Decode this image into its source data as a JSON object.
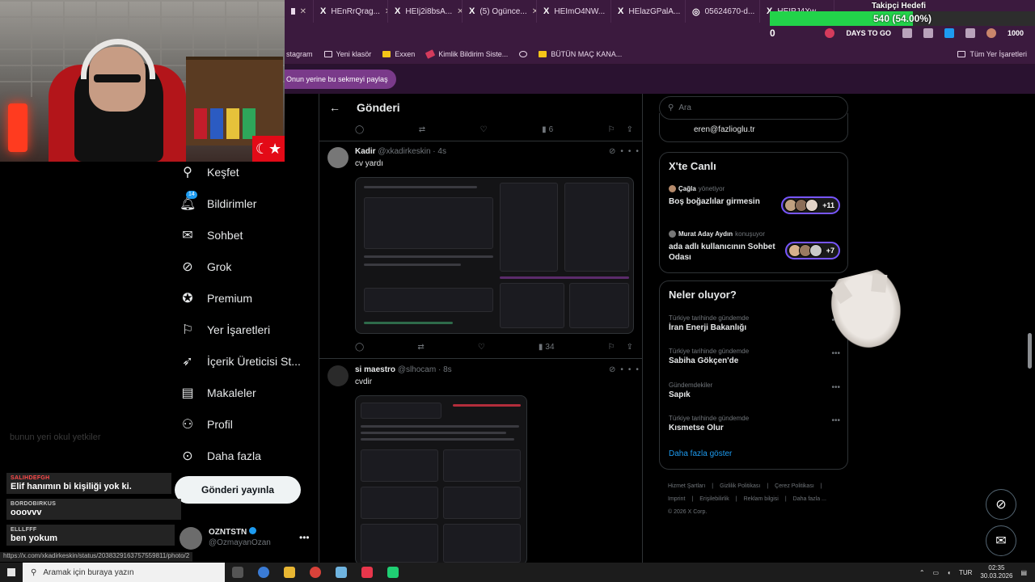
{
  "browser": {
    "tabs": [
      "HEnRrQrag...",
      "HEIj2i8bsA...",
      "(5) Ogünce...",
      "HEImO4NW...",
      "HElazGPalA...",
      "05624670-d...",
      "HEIPJ4Xw..."
    ],
    "bookmarks": [
      "stagram",
      "Yeni klasör",
      "Exxen",
      "Kimlik Bildirim Siste...",
      "BÜTÜN MAÇ KANA..."
    ],
    "bookmarks_right": "Tüm Yer İşaretleri",
    "toolbar_text": "DAYS TO GO",
    "toolbar_count": "1000",
    "share_prompt": "Onun yerine bu sekmeyi paylaş"
  },
  "stream_overlay": {
    "goal_title": "Takipçi Hedefi",
    "goal_text": "540 (54.00%)",
    "goal_progress": 0.54,
    "goal_left_value": "0",
    "flag_symbol": "☾★"
  },
  "nav": {
    "items": [
      {
        "label": "Keşfet",
        "icon": "search-icon"
      },
      {
        "label": "Bildirimler",
        "icon": "bell-icon",
        "badge": "14"
      },
      {
        "label": "Sohbet",
        "icon": "mail-icon"
      },
      {
        "label": "Grok",
        "icon": "grok-icon"
      },
      {
        "label": "Premium",
        "icon": "premium-icon"
      },
      {
        "label": "Yer İşaretleri",
        "icon": "bookmark-icon"
      },
      {
        "label": "İçerik Üreticisi St...",
        "icon": "rocket-icon"
      },
      {
        "label": "Makaleler",
        "icon": "article-icon"
      },
      {
        "label": "Profil",
        "icon": "profile-icon"
      },
      {
        "label": "Daha fazla",
        "icon": "more-circle-icon"
      }
    ],
    "post_button": "Gönderi yayınla",
    "account": {
      "name": "OZNTSTN",
      "handle": "@OzmayanOzan"
    }
  },
  "chat": [
    {
      "user": "SALIHDEFGH",
      "message": "Elif hanımın bi kişiliği yok ki."
    },
    {
      "user": "BORDOBIRKUS",
      "message": "ooovvv"
    },
    {
      "user": "ELLLFFF",
      "message": "ben yokum"
    }
  ],
  "chat_ghost": "bunun yeri okul yetkiler",
  "feed": {
    "title": "Gönderi",
    "top_actions": {
      "views": "6"
    },
    "posts": [
      {
        "name": "Kadir",
        "handle": "@xkadirkeskin",
        "time": "4s",
        "text": "cv yardı",
        "views": "34"
      },
      {
        "name": "si maestro",
        "handle": "@slhocam",
        "time": "8s",
        "text": "cvdir",
        "views": ""
      }
    ]
  },
  "sidebar": {
    "search_placeholder": "Ara",
    "email": "eren@fazlioglu.tr",
    "live_title": "X'te Canlı",
    "spaces": [
      {
        "host": "Çağla",
        "role": "yönetiyor",
        "title": "Boş boğazlılar girmesin",
        "count": "+11"
      },
      {
        "host": "Murat Aday Aydın",
        "role": "konuşuyor",
        "title": "ada adlı kullanıcının Sohbet Odası",
        "count": "+7"
      }
    ],
    "trends_title": "Neler oluyor?",
    "trends": [
      {
        "context": "Türkiye tarihinde gündemde",
        "topic": "İran Enerji Bakanlığı"
      },
      {
        "context": "Türkiye tarihinde gündemde",
        "topic": "Sabiha Gökçen'de"
      },
      {
        "context": "Gündemdekiler",
        "topic": "Sapık"
      },
      {
        "context": "Türkiye tarihinde gündemde",
        "topic": "Kısmetse Olur"
      }
    ],
    "show_more": "Daha fazla göster",
    "footer": [
      "Hizmet Şartları",
      "|",
      "Gizlilik Politikası",
      "|",
      "Çerez Politikası",
      "|",
      "Imprint",
      "|",
      "Erişilebilirlik",
      "|",
      "Reklam bilgisi",
      "|",
      "Daha fazla ...",
      "© 2026 X Corp."
    ]
  },
  "status_url": "https://x.com/xkadirkeskin/status/2038329163757559811/photo/2",
  "taskbar": {
    "search_placeholder": "Aramak için buraya yazın",
    "language": "TUR",
    "time": "02:35",
    "date": "30.03.2026"
  },
  "colors": {
    "accent": "#1d9bf0",
    "goal_bar": "#22d34a",
    "browser": "#3b1a3e",
    "space_ring": "#7856ff"
  }
}
